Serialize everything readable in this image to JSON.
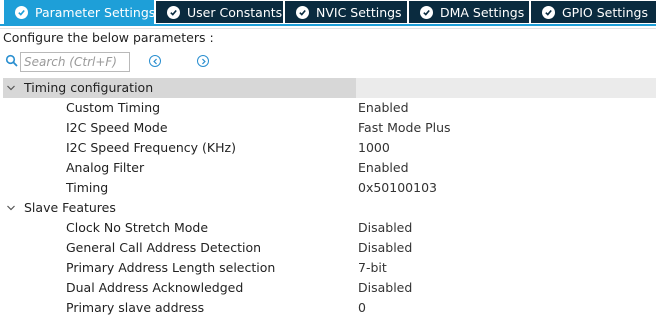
{
  "tabs": [
    {
      "label": "Parameter Settings",
      "active": true
    },
    {
      "label": "User Constants",
      "active": false
    },
    {
      "label": "NVIC Settings",
      "active": false
    },
    {
      "label": "DMA Settings",
      "active": false
    },
    {
      "label": "GPIO Settings",
      "active": false
    }
  ],
  "configure_label": "Configure the below parameters :",
  "search": {
    "placeholder": "Search (Ctrl+F)",
    "value": ""
  },
  "icons": {
    "search": "search-icon",
    "prev": "chevron-left-circle-icon",
    "next": "chevron-right-circle-icon",
    "tab_check": "check-circle-icon",
    "section_toggle": "chevron-down-icon"
  },
  "sections": [
    {
      "label": "Timing configuration",
      "expanded": true,
      "params": [
        {
          "name": "Custom Timing",
          "value": "Enabled"
        },
        {
          "name": "I2C Speed Mode",
          "value": "Fast Mode Plus"
        },
        {
          "name": "I2C Speed Frequency (KHz)",
          "value": "1000"
        },
        {
          "name": "Analog Filter",
          "value": "Enabled"
        },
        {
          "name": "Timing",
          "value": "0x50100103"
        }
      ]
    },
    {
      "label": "Slave Features",
      "expanded": true,
      "params": [
        {
          "name": "Clock No Stretch Mode",
          "value": "Disabled"
        },
        {
          "name": "General Call Address Detection",
          "value": "Disabled"
        },
        {
          "name": "Primary Address Length selection",
          "value": "7-bit"
        },
        {
          "name": "Dual Address Acknowledged",
          "value": "Disabled"
        },
        {
          "name": "Primary slave address",
          "value": "0"
        }
      ]
    }
  ],
  "colors": {
    "active_tab": "#1e9fd8",
    "inactive_tab": "#0a2b3f",
    "tab_text": "#ffffff",
    "section_highlight": "#d7d7d7",
    "nav_icon": "#2a8fd0"
  }
}
